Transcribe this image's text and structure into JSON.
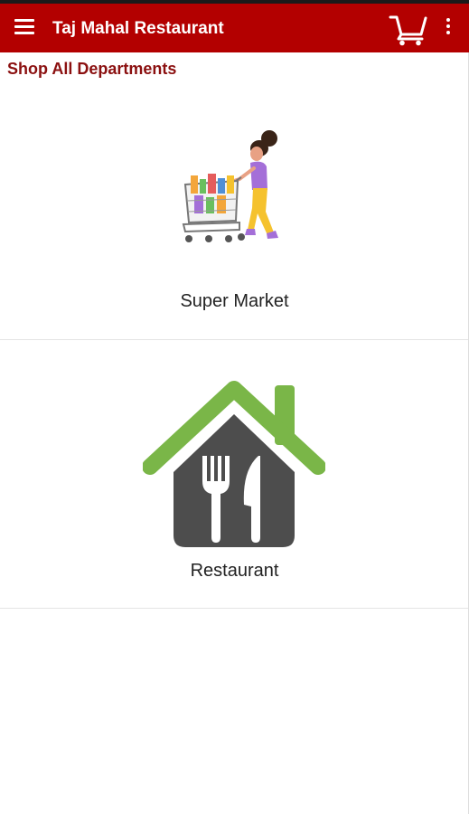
{
  "app": {
    "title": "Taj Mahal Restaurant",
    "brand_color": "#b30000"
  },
  "toolbar": {
    "menu_icon": "hamburger-menu-icon",
    "cart_icon": "shopping-cart-icon",
    "more_icon": "more-vertical-icon"
  },
  "section": {
    "title": "Shop All Departments",
    "title_color": "#8b1010"
  },
  "departments": [
    {
      "label": "Super Market",
      "image": "supermarket-shopper-illustration"
    },
    {
      "label": "Restaurant",
      "image": "restaurant-house-fork-knife-icon",
      "accent_color": "#7ab648"
    }
  ]
}
